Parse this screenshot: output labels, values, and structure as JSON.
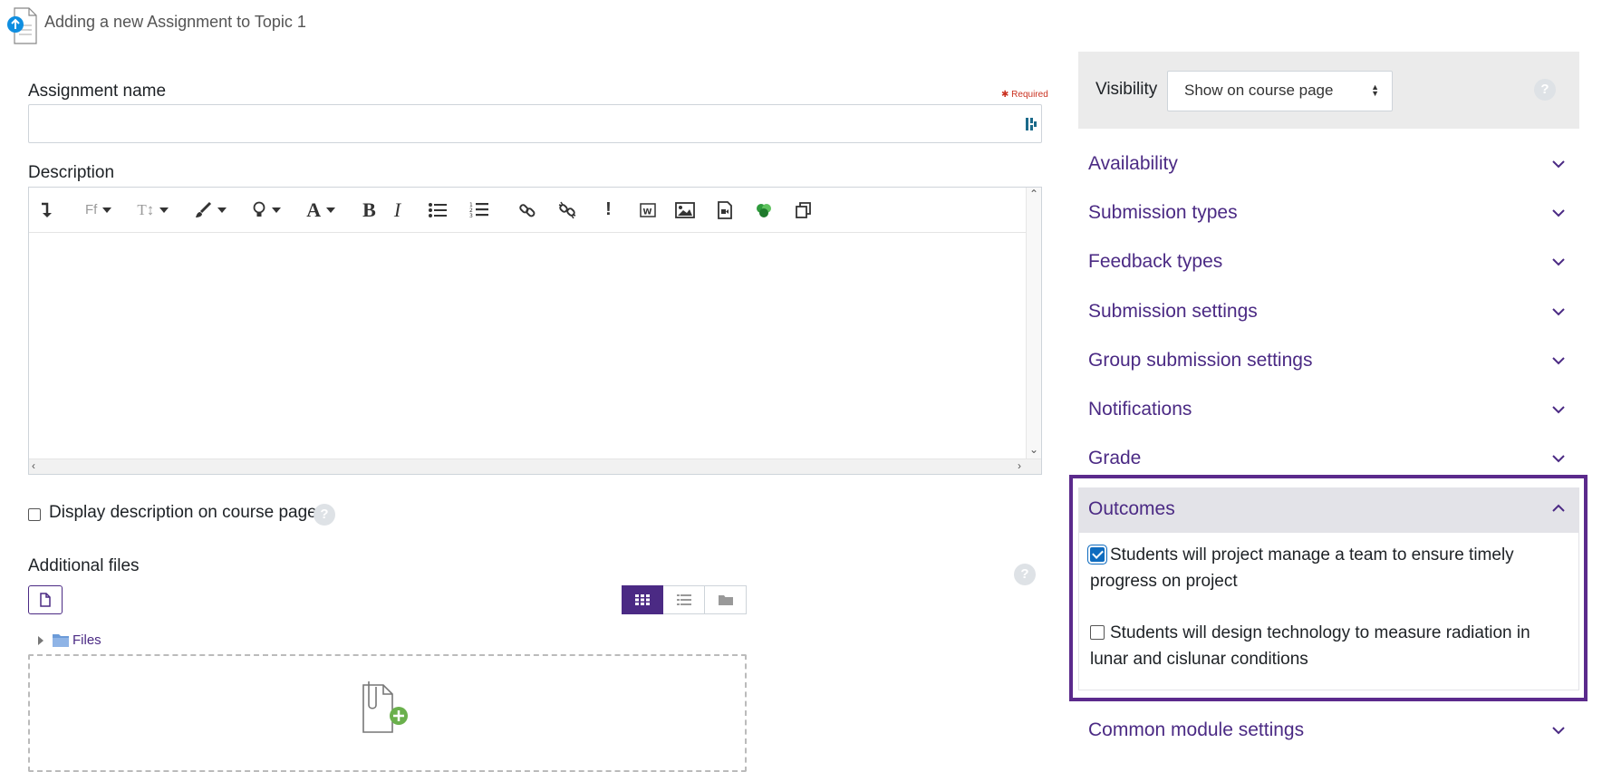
{
  "header": {
    "title": "Adding a new Assignment to Topic 1"
  },
  "form": {
    "assignment_name_label": "Assignment name",
    "required_label": "Required",
    "assignment_name_value": "",
    "description_label": "Description",
    "display_description_label": "Display description on course page",
    "additional_files_label": "Additional files",
    "files_folder_label": "Files"
  },
  "toolbar": {
    "items": [
      "collapse",
      "font-family",
      "font-size",
      "style",
      "accessibility",
      "font-color",
      "bold",
      "italic",
      "unordered-list",
      "ordered-list",
      "link",
      "unlink",
      "emoticon",
      "word-import",
      "image",
      "media",
      "recordrtc",
      "copy"
    ],
    "font_family_glyph": "Ff",
    "font_size_glyph": "T↕",
    "bold_glyph": "B",
    "italic_glyph": "I",
    "font_color_glyph": "A",
    "emoticon_glyph": "!"
  },
  "sidebar": {
    "visibility_label": "Visibility",
    "visibility_value": "Show on course page",
    "sections": [
      "Availability",
      "Submission types",
      "Feedback types",
      "Submission settings",
      "Group submission settings",
      "Notifications",
      "Grade"
    ],
    "outcomes": {
      "title": "Outcomes",
      "items": [
        {
          "label": "Students will project manage a team to ensure timely progress on project",
          "checked": true
        },
        {
          "label": "Students will design technology to measure radiation in lunar and cislunar conditions",
          "checked": false
        }
      ]
    },
    "common_module_settings": "Common module settings"
  },
  "colors": {
    "accent": "#4b2a84",
    "highlight_frame": "#5b2a8c",
    "check": "#0f6cbf",
    "required": "#ca3120"
  }
}
